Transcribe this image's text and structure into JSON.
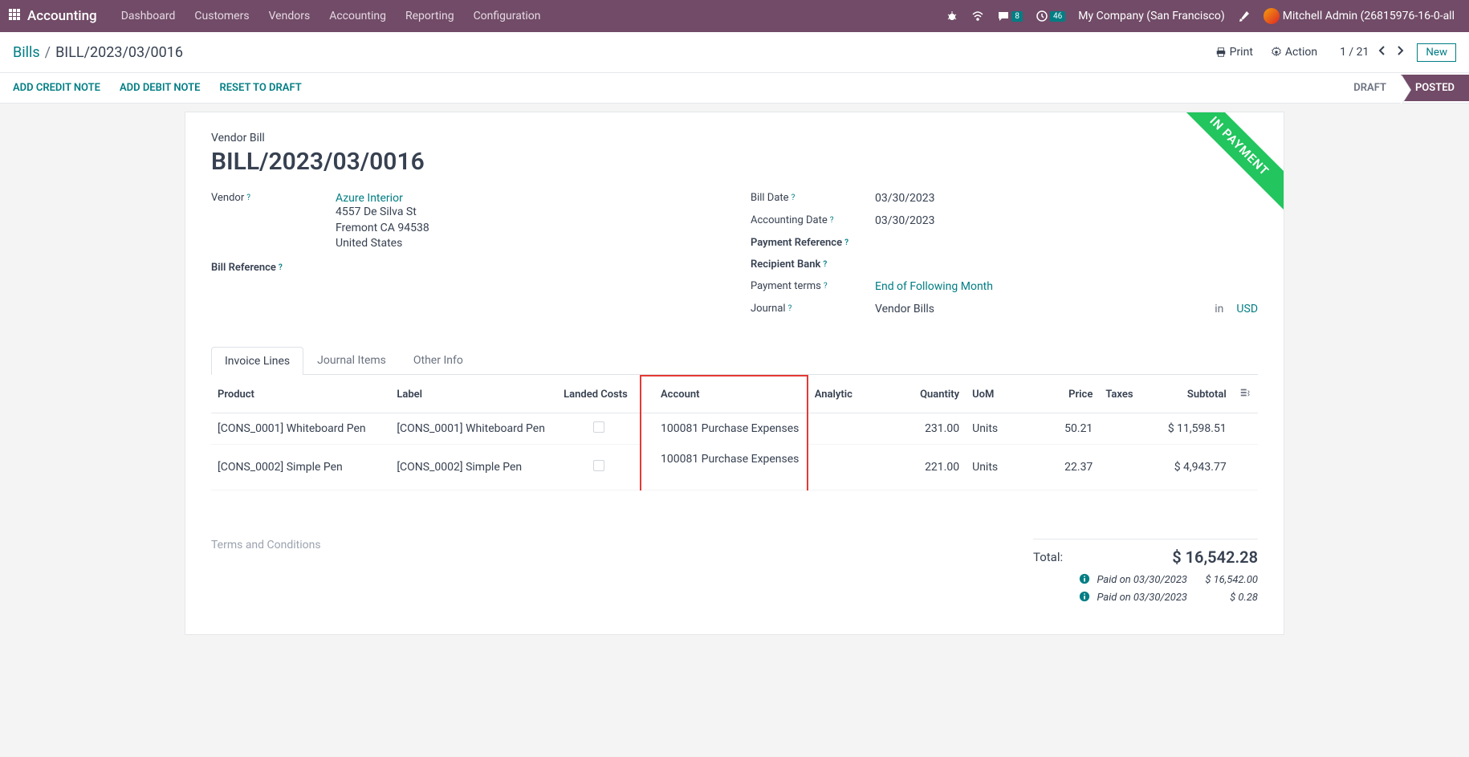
{
  "topnav": {
    "app": "Accounting",
    "menus": [
      "Dashboard",
      "Customers",
      "Vendors",
      "Accounting",
      "Reporting",
      "Configuration"
    ],
    "chat_badge": "8",
    "clock_badge": "46",
    "company": "My Company (San Francisco)",
    "user": "Mitchell Admin (26815976-16-0-all"
  },
  "breadcrumb": {
    "root": "Bills",
    "current": "BILL/2023/03/0016"
  },
  "actions": {
    "print": "Print",
    "action": "Action",
    "pager": "1 / 21",
    "new": "New"
  },
  "status_actions": [
    "ADD CREDIT NOTE",
    "ADD DEBIT NOTE",
    "RESET TO DRAFT"
  ],
  "status_tabs": {
    "draft": "DRAFT",
    "posted": "POSTED"
  },
  "ribbon": "IN PAYMENT",
  "doc": {
    "type": "Vendor Bill",
    "name": "BILL/2023/03/0016",
    "vendor_label": "Vendor",
    "vendor": "Azure Interior",
    "addr1": "4557 De Silva St",
    "addr2": "Fremont CA 94538",
    "addr3": "United States",
    "bill_ref_label": "Bill Reference",
    "bill_date_label": "Bill Date",
    "bill_date": "03/30/2023",
    "acct_date_label": "Accounting Date",
    "acct_date": "03/30/2023",
    "payref_label": "Payment Reference",
    "recipient_bank_label": "Recipient Bank",
    "payterms_label": "Payment terms",
    "payterms": "End of Following Month",
    "journal_label": "Journal",
    "journal": "Vendor Bills",
    "journal_in": "in",
    "currency": "USD"
  },
  "tabs": [
    "Invoice Lines",
    "Journal Items",
    "Other Info"
  ],
  "headers": {
    "product": "Product",
    "label": "Label",
    "landed": "Landed Costs",
    "account": "Account",
    "analytic": "Analytic",
    "qty": "Quantity",
    "uom": "UoM",
    "price": "Price",
    "taxes": "Taxes",
    "subtotal": "Subtotal"
  },
  "lines": [
    {
      "product": "[CONS_0001] Whiteboard Pen",
      "label": "[CONS_0001] Whiteboard Pen",
      "account": "100081 Purchase Expenses",
      "qty": "231.00",
      "uom": "Units",
      "price": "50.21",
      "subtotal": "$ 11,598.51"
    },
    {
      "product": "[CONS_0002] Simple Pen",
      "label": "[CONS_0002] Simple Pen",
      "account": "100081 Purchase Expenses",
      "qty": "221.00",
      "uom": "Units",
      "price": "22.37",
      "subtotal": "$ 4,943.77"
    }
  ],
  "footer": {
    "terms": "Terms and Conditions",
    "total_label": "Total:",
    "total": "$ 16,542.28",
    "paid1_label": "Paid on 03/30/2023",
    "paid1_amount": "$ 16,542.00",
    "paid2_label": "Paid on 03/30/2023",
    "paid2_amount": "$ 0.28"
  }
}
